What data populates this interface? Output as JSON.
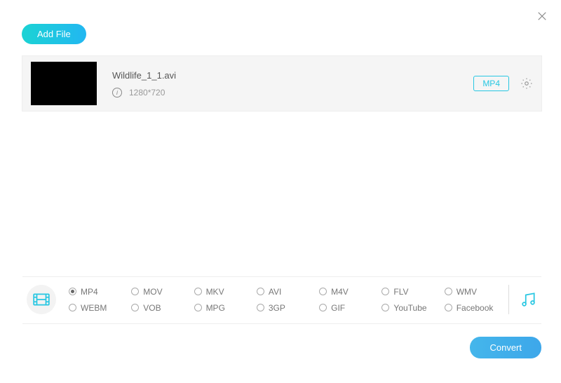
{
  "header": {
    "add_file_label": "Add File"
  },
  "file": {
    "name": "Wildlife_1_1.avi",
    "resolution": "1280*720",
    "target_format": "MP4"
  },
  "formats": {
    "options": [
      "MP4",
      "MOV",
      "MKV",
      "AVI",
      "M4V",
      "FLV",
      "WMV",
      "WEBM",
      "VOB",
      "MPG",
      "3GP",
      "GIF",
      "YouTube",
      "Facebook"
    ],
    "selected_index": 0
  },
  "footer": {
    "convert_label": "Convert"
  }
}
